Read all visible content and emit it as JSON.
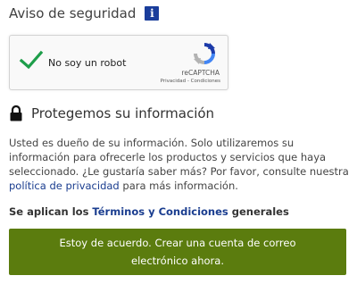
{
  "security": {
    "title": "Aviso de seguridad",
    "info_icon": "i"
  },
  "captcha": {
    "label": "No soy un robot",
    "checked": true,
    "brand": "reCAPTCHA",
    "links": "Privacidad - Condiciones",
    "icons": {
      "check": "checkmark-icon",
      "logo": "recaptcha-logo-icon"
    }
  },
  "protection": {
    "title": "Protegemos su información",
    "icon": "lock-icon"
  },
  "info": {
    "text_before_link": "Usted es dueño de su información. Solo utilizaremos su información para ofrecerle los productos y servicios que haya seleccionado. ¿Le gustaría saber más? Por favor, consulte nuestra ",
    "link_text": "política de privacidad",
    "text_after_link": " para más información."
  },
  "terms": {
    "prefix": "Se aplican los ",
    "link_text": "Términos y Condiciones",
    "suffix": " generales"
  },
  "agree_button": {
    "label": "Estoy de acuerdo. Crear una cuenta de correo electrónico ahora."
  },
  "colors": {
    "info_icon_bg": "#1a3d9b",
    "check_green": "#1e9e4a",
    "link_blue": "#1a3d8f",
    "button_green": "#5b7c0e"
  }
}
